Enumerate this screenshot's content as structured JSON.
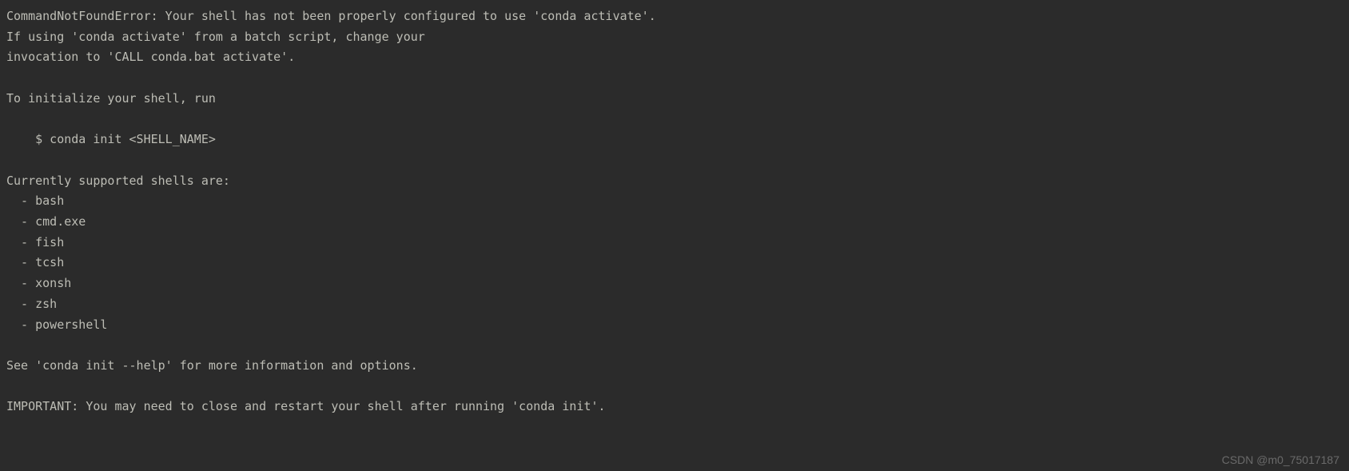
{
  "terminal": {
    "lines": [
      "CommandNotFoundError: Your shell has not been properly configured to use 'conda activate'.",
      "If using 'conda activate' from a batch script, change your",
      "invocation to 'CALL conda.bat activate'.",
      "",
      "To initialize your shell, run",
      "",
      "    $ conda init <SHELL_NAME>",
      "",
      "Currently supported shells are:",
      "  - bash",
      "  - cmd.exe",
      "  - fish",
      "  - tcsh",
      "  - xonsh",
      "  - zsh",
      "  - powershell",
      "",
      "See 'conda init --help' for more information and options.",
      "",
      "IMPORTANT: You may need to close and restart your shell after running 'conda init'."
    ]
  },
  "watermark": "CSDN @m0_75017187"
}
